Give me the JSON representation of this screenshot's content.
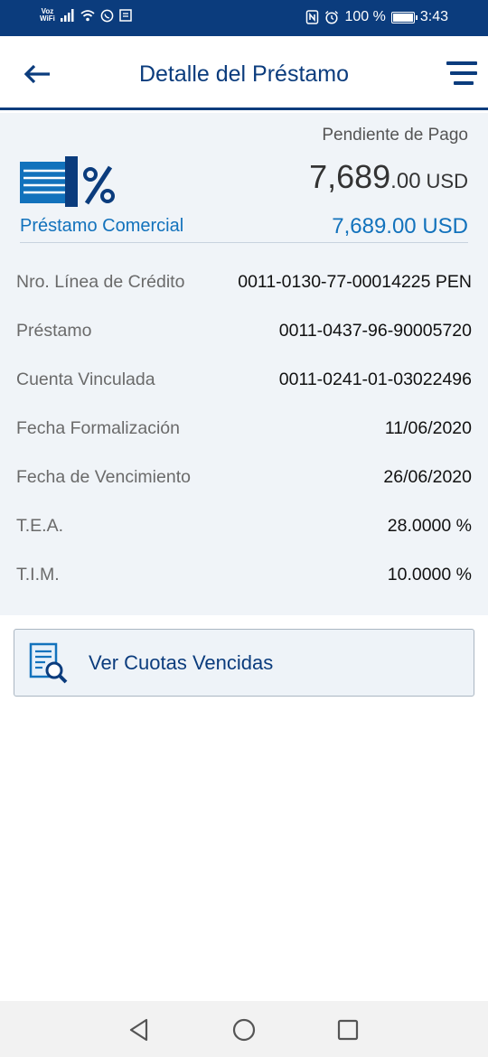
{
  "status_bar": {
    "voz_line1": "Voz",
    "voz_line2": "WiFi",
    "battery_text": "100 %",
    "time": "3:43"
  },
  "header": {
    "title": "Detalle del Préstamo",
    "back_icon": "arrow-left-icon",
    "menu_icon": "hamburger-icon"
  },
  "summary": {
    "status_label": "Pendiente de Pago",
    "amount_integer": "7,689",
    "amount_decimal": ".00",
    "currency": "USD",
    "loan_type": "Préstamo Comercial",
    "amount_full": "7,689.00 USD"
  },
  "details": [
    {
      "label": "Nro. Línea de Crédito",
      "value": "0011-0130-77-00014225 PEN"
    },
    {
      "label": "Préstamo",
      "value": "0011-0437-96-90005720"
    },
    {
      "label": "Cuenta Vinculada",
      "value": "0011-0241-01-03022496"
    },
    {
      "label": "Fecha Formalización",
      "value": "11/06/2020"
    },
    {
      "label": "Fecha de Vencimiento",
      "value": "26/06/2020"
    },
    {
      "label": "T.E.A.",
      "value": "28.0000 %"
    },
    {
      "label": "T.I.M.",
      "value": "10.0000 %"
    }
  ],
  "action": {
    "label": "Ver Cuotas Vencidas",
    "icon": "document-search-icon"
  },
  "colors": {
    "brand": "#0b3c7d",
    "accent": "#1272bc",
    "panel_bg": "#f0f4f8"
  }
}
